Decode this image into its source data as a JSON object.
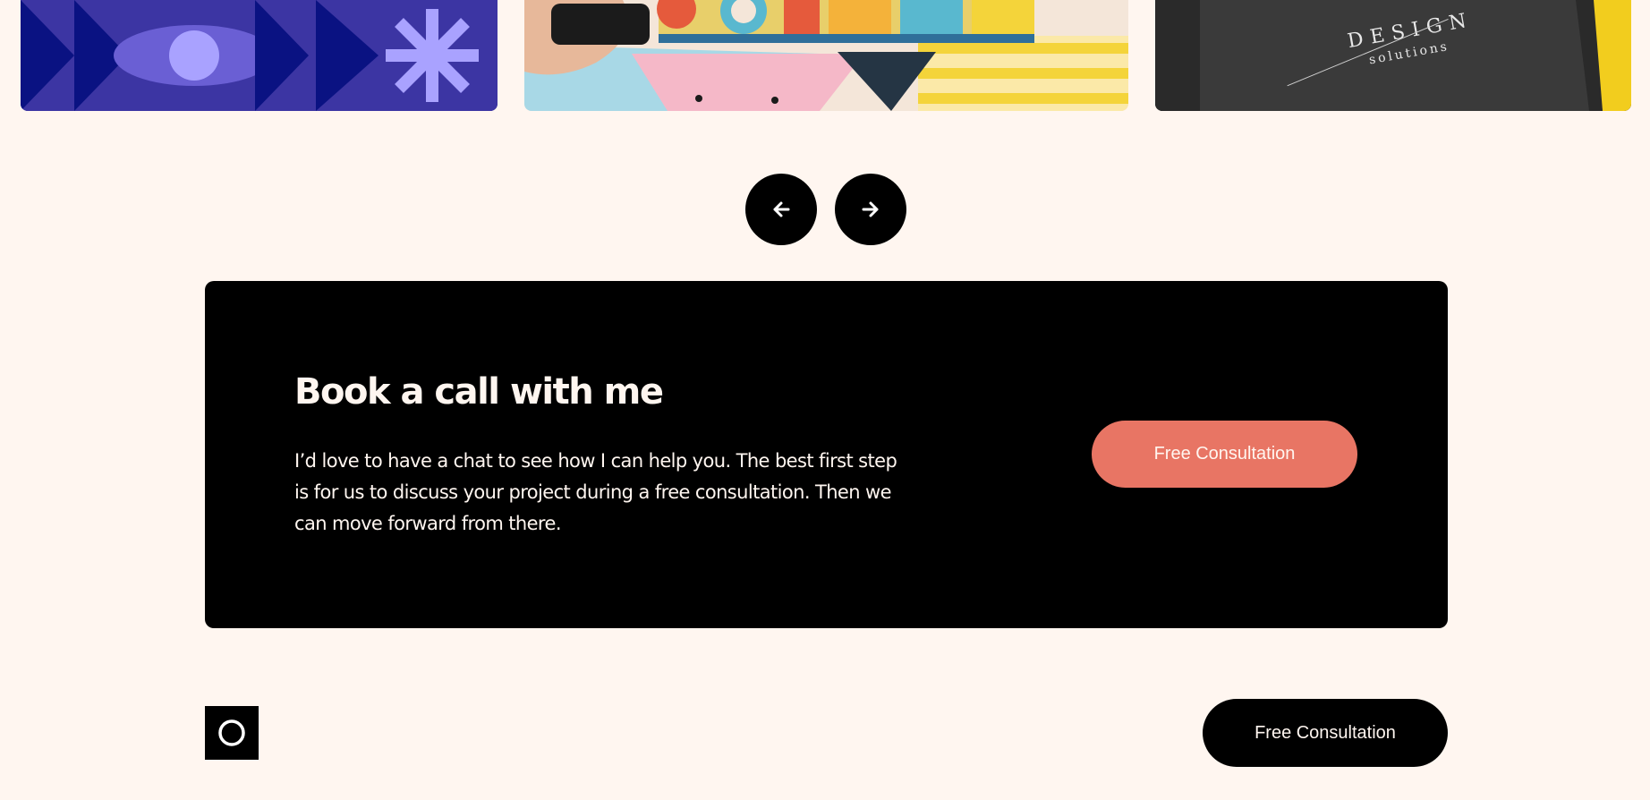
{
  "gallery": {
    "cards": [
      {
        "name": "eye-pattern-artwork"
      },
      {
        "name": "colorful-illustration-print"
      },
      {
        "name": "design-solutions-notebook",
        "text_line1": "DESIGN",
        "text_line2": "solutions"
      }
    ]
  },
  "carousel": {
    "prev_icon": "arrow-left-icon",
    "next_icon": "arrow-right-icon"
  },
  "cta": {
    "heading": "Book a call with me",
    "body": "I’d love to have a chat to see how I can help you. The best first step is for us to discuss your project during a free consultation. Then we can move forward from there.",
    "button_label": "Free Consultation"
  },
  "footer": {
    "logo_icon": "circle-logo-icon",
    "button_label": "Free Consultation"
  },
  "colors": {
    "page_background": "#fff6f0",
    "panel_background": "#000000",
    "accent_coral": "#e87564",
    "text_light": "#fff6f0"
  }
}
